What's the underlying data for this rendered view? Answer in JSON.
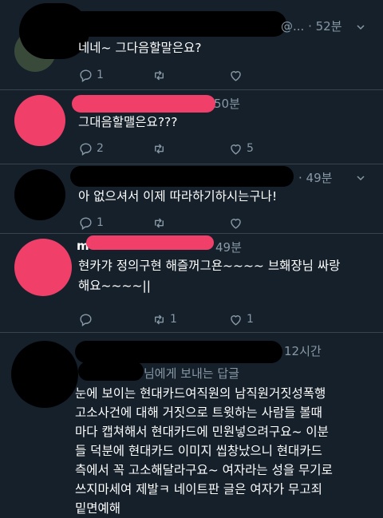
{
  "colors": {
    "background": "#15202b",
    "muted": "#8899a6",
    "divider": "#38444d",
    "redaction": "#000000",
    "pink_scribble": "#f0406a",
    "reply_link": "#1da1f2"
  },
  "tweets": [
    {
      "meta_suffix": "@... · 52분",
      "text": "네네~ 그다음할말은요?",
      "actions": {
        "reply_count": "1",
        "retweet_count": "",
        "like_count": ""
      }
    },
    {
      "meta_suffix": "50분",
      "text": "그대음할맬은요???",
      "actions": {
        "reply_count": "2",
        "retweet_count": "",
        "like_count": "5"
      }
    },
    {
      "meta_suffix": "· 49분",
      "text": "아 없으셔서 이제 따라하기하시는구나!",
      "actions": {
        "reply_count": "1",
        "retweet_count": "",
        "like_count": ""
      }
    },
    {
      "name_prefix": "m",
      "meta_suffix": "49분",
      "text": "현카갸 정의구현 해즐꺼그욘~~~~ 브홰쟝님 싸랑\n해요~~~~||",
      "actions": {
        "reply_count": "",
        "retweet_count": "1",
        "like_count": "1"
      }
    },
    {
      "meta_suffix": "12시간",
      "reply_to": "님에게 보내는 답글",
      "text": "눈에 보이는 현대카드여직원의 남직원거짓성폭행\n고소사건에 대해 거짓으로 트윗하는 사람들 볼때\n마다 캡쳐해서 현대카드에 민원넣으려구요~ 이분\n들 덕분에 현대카드 이미지 씹창났으니 현대카드\n측에서 꼭 고소해달라구요~ 여자라는 성을 무기로\n쓰지마세여 제발ㅋ 네이트판 글은 여자가 무고죄\n밑면예해"
    }
  ]
}
